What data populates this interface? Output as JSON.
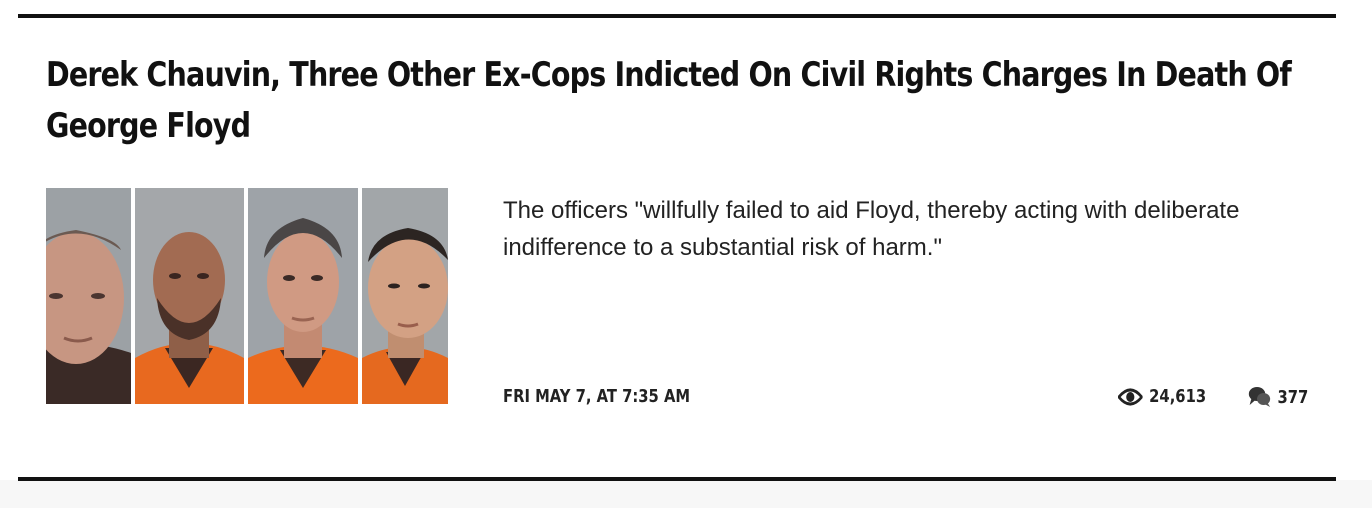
{
  "article": {
    "headline": "Derek Chauvin, Three Other Ex-Cops Indicted On Civil Rights Charges In Death Of George Floyd",
    "summary": "The officers \"willfully failed to aid Floyd, thereby acting with deliberate indifference to a substantial risk of harm.\"",
    "date": "FRI MAY 7, AT 7:35 AM",
    "views": "24,613",
    "comments": "377",
    "icons": {
      "views": "eye-icon",
      "comments": "comment-bubbles-icon"
    }
  }
}
